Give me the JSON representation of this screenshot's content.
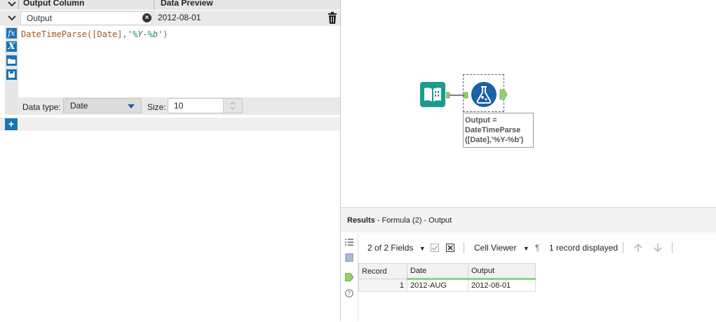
{
  "formula_panel": {
    "col_header_output": "Output Column",
    "col_header_preview": "Data Preview",
    "output_name": "Output",
    "preview_value": "2012-08-01",
    "expression_func": "DateTimeParse([Date],",
    "expression_arg": "'%Y-%b'",
    "expression_close": ")",
    "data_type_label": "Data type:",
    "data_type_value": "Date",
    "size_label": "Size:",
    "size_value": "10",
    "add_label": "+"
  },
  "canvas": {
    "annotation": "Output = DateTimeParse ([Date],'%Y-%b')",
    "input_icon": "book-icon",
    "formula_icon": "flask-icon"
  },
  "results": {
    "title": "Results",
    "subtitle": "- Formula (2) - Output",
    "fields_label": "2 of 2 Fields",
    "cell_viewer_label": "Cell Viewer",
    "pilcrow": "¶",
    "records_label": "1 record displayed",
    "columns": [
      "Record",
      "Date",
      "Output"
    ],
    "rows": [
      [
        "1",
        "2012-AUG",
        "2012-08-01"
      ]
    ]
  },
  "colors": {
    "accent_blue": "#1a73b5",
    "teal": "#1a9c8c",
    "green_anchor": "#8fd36a"
  }
}
